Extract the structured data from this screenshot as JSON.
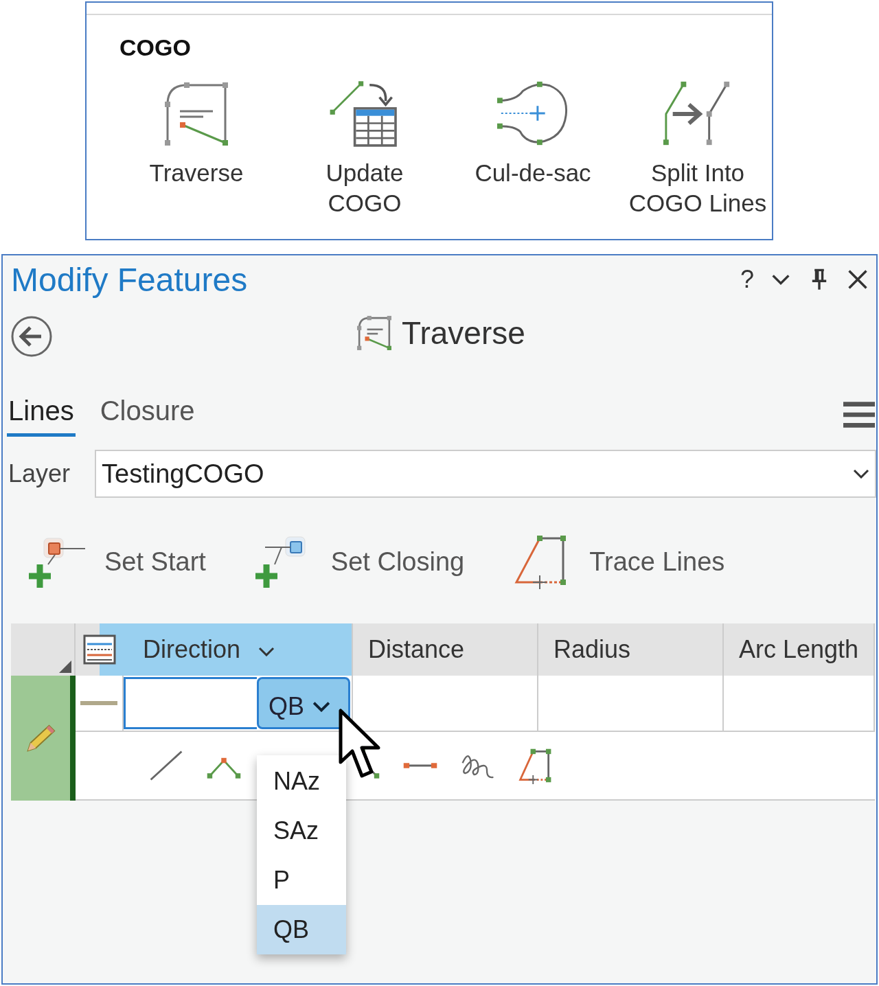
{
  "ribbon": {
    "group_title": "COGO",
    "tools": [
      {
        "kind": "traverse",
        "lines": [
          "Traverse"
        ]
      },
      {
        "kind": "update",
        "lines": [
          "Update",
          "COGO"
        ]
      },
      {
        "kind": "culdesac",
        "lines": [
          "Cul-de-sac"
        ]
      },
      {
        "kind": "split",
        "lines": [
          "Split Into",
          "COGO Lines"
        ]
      }
    ]
  },
  "pane": {
    "title": "Modify Features",
    "help": "?",
    "tool_title": "Traverse",
    "tabs": [
      {
        "label": "Lines",
        "selected": true
      },
      {
        "label": "Closure",
        "selected": false
      }
    ],
    "layer": {
      "label": "Layer",
      "value": "TestingCOGO"
    },
    "actions": [
      {
        "kind": "start",
        "label": "Set Start"
      },
      {
        "kind": "closing",
        "label": "Set Closing"
      },
      {
        "kind": "trace",
        "label": "Trace Lines"
      }
    ],
    "grid": {
      "columns": [
        {
          "label": "Direction",
          "selected": true
        },
        {
          "label": "Distance",
          "selected": false
        },
        {
          "label": "Radius",
          "selected": false
        },
        {
          "label": "Arc Length",
          "selected": false
        }
      ],
      "unit": "QB",
      "unit_options": [
        {
          "label": "NAz",
          "selected": false
        },
        {
          "label": "SAz",
          "selected": false
        },
        {
          "label": "P",
          "selected": false
        },
        {
          "label": "QB",
          "selected": true
        }
      ]
    }
  }
}
